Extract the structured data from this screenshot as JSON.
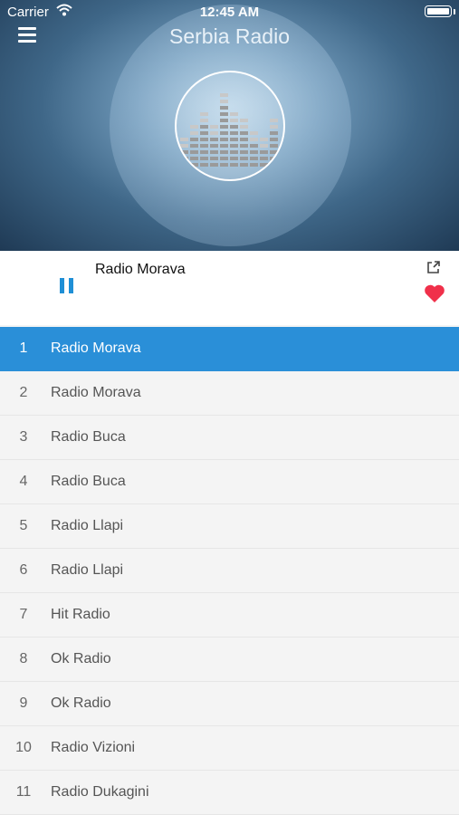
{
  "status_bar": {
    "carrier": "Carrier",
    "time": "12:45 AM"
  },
  "header": {
    "title": "Serbia Radio"
  },
  "player": {
    "now_playing": "Radio Morava",
    "accent": "#1f8fd6",
    "favorite_color": "#f0304a"
  },
  "stations": [
    {
      "num": "1",
      "name": "Radio Morava",
      "active": true
    },
    {
      "num": "2",
      "name": "Radio Morava"
    },
    {
      "num": "3",
      "name": "Radio Buca"
    },
    {
      "num": "4",
      "name": "Radio Buca"
    },
    {
      "num": "5",
      "name": "Radio Llapi"
    },
    {
      "num": "6",
      "name": "Radio Llapi"
    },
    {
      "num": "7",
      "name": "Hit Radio"
    },
    {
      "num": "8",
      "name": "Ok Radio"
    },
    {
      "num": "9",
      "name": "Ok Radio"
    },
    {
      "num": "10",
      "name": "Radio Vizioni"
    },
    {
      "num": "11",
      "name": "Radio Dukagini"
    }
  ]
}
